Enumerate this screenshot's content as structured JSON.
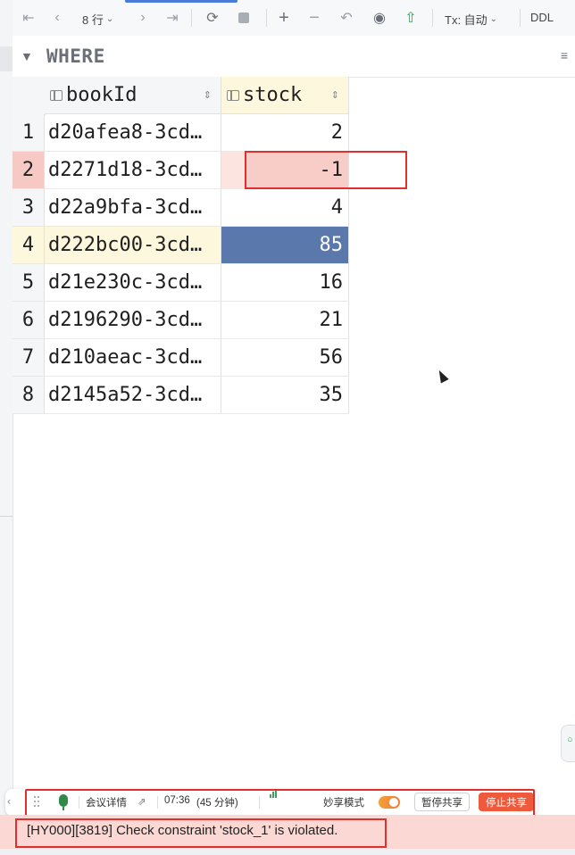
{
  "toolbar": {
    "rows_count": "8 行",
    "tx_mode": "Tx: 自动",
    "ddl_label": "DDL"
  },
  "filter": {
    "where_label": "WHERE"
  },
  "table": {
    "columns": [
      {
        "name": "bookId",
        "icon": "key-column-icon"
      },
      {
        "name": "stock",
        "icon": "column-icon"
      }
    ],
    "rows": [
      {
        "num": "1",
        "bookId": "d20afea8-3cd…",
        "stock": "2"
      },
      {
        "num": "2",
        "bookId": "d2271d18-3cd…",
        "stock": "-1"
      },
      {
        "num": "3",
        "bookId": "d22a9bfa-3cd…",
        "stock": "4"
      },
      {
        "num": "4",
        "bookId": "d222bc00-3cd…",
        "stock": "85"
      },
      {
        "num": "5",
        "bookId": "d21e230c-3cd…",
        "stock": "16"
      },
      {
        "num": "6",
        "bookId": "d2196290-3cd…",
        "stock": "21"
      },
      {
        "num": "7",
        "bookId": "d210aeac-3cd…",
        "stock": "56"
      },
      {
        "num": "8",
        "bookId": "d2145a52-3cd…",
        "stock": "35"
      }
    ]
  },
  "meeting_bar": {
    "details": "会议详情",
    "time": "07:36",
    "duration": "(45 分钟)",
    "mode_label": "妙享模式",
    "pause_share": "暂停共享",
    "stop_share": "停止共享"
  },
  "status": {
    "error_message": "[HY000][3819] Check constraint 'stock_1' is violated."
  },
  "colors": {
    "error_outline": "#e0302d",
    "selected_cell": "#5b78ad",
    "error_row": "#f8cdc8",
    "current_row": "#fdf7dd"
  }
}
